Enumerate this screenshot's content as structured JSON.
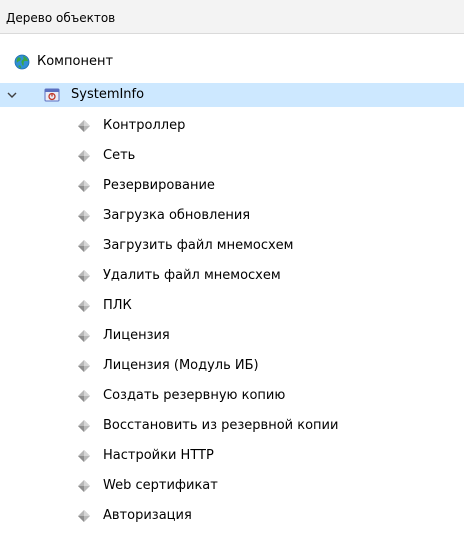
{
  "panel": {
    "title": "Дерево объектов"
  },
  "colors": {
    "selection": "#cde8ff",
    "header_bg": "#f3f3f3",
    "globe": "#3aa544",
    "systeminfo_icon": "#5b6fc0"
  },
  "tree": {
    "root": {
      "label": "Компонент",
      "icon": "globe-icon"
    },
    "systeminfo": {
      "label": "SystemInfo",
      "icon": "systeminfo-icon",
      "expanded": true,
      "selected": true
    },
    "children": [
      {
        "label": "Контроллер",
        "icon": "node-icon"
      },
      {
        "label": "Сеть",
        "icon": "node-icon"
      },
      {
        "label": "Резервирование",
        "icon": "node-icon"
      },
      {
        "label": "Загрузка обновления",
        "icon": "node-icon"
      },
      {
        "label": "Загрузить файл мнемосхем",
        "icon": "node-icon"
      },
      {
        "label": "Удалить файл мнемосхем",
        "icon": "node-icon"
      },
      {
        "label": "ПЛК",
        "icon": "node-icon"
      },
      {
        "label": "Лицензия",
        "icon": "node-icon"
      },
      {
        "label": "Лицензия (Модуль ИБ)",
        "icon": "node-icon"
      },
      {
        "label": "Создать резервную копию",
        "icon": "node-icon"
      },
      {
        "label": "Восстановить из резервной копии",
        "icon": "node-icon"
      },
      {
        "label": "Настройки HTTP",
        "icon": "node-icon"
      },
      {
        "label": "Web сертификат",
        "icon": "node-icon"
      },
      {
        "label": "Авторизация",
        "icon": "node-icon"
      }
    ]
  }
}
